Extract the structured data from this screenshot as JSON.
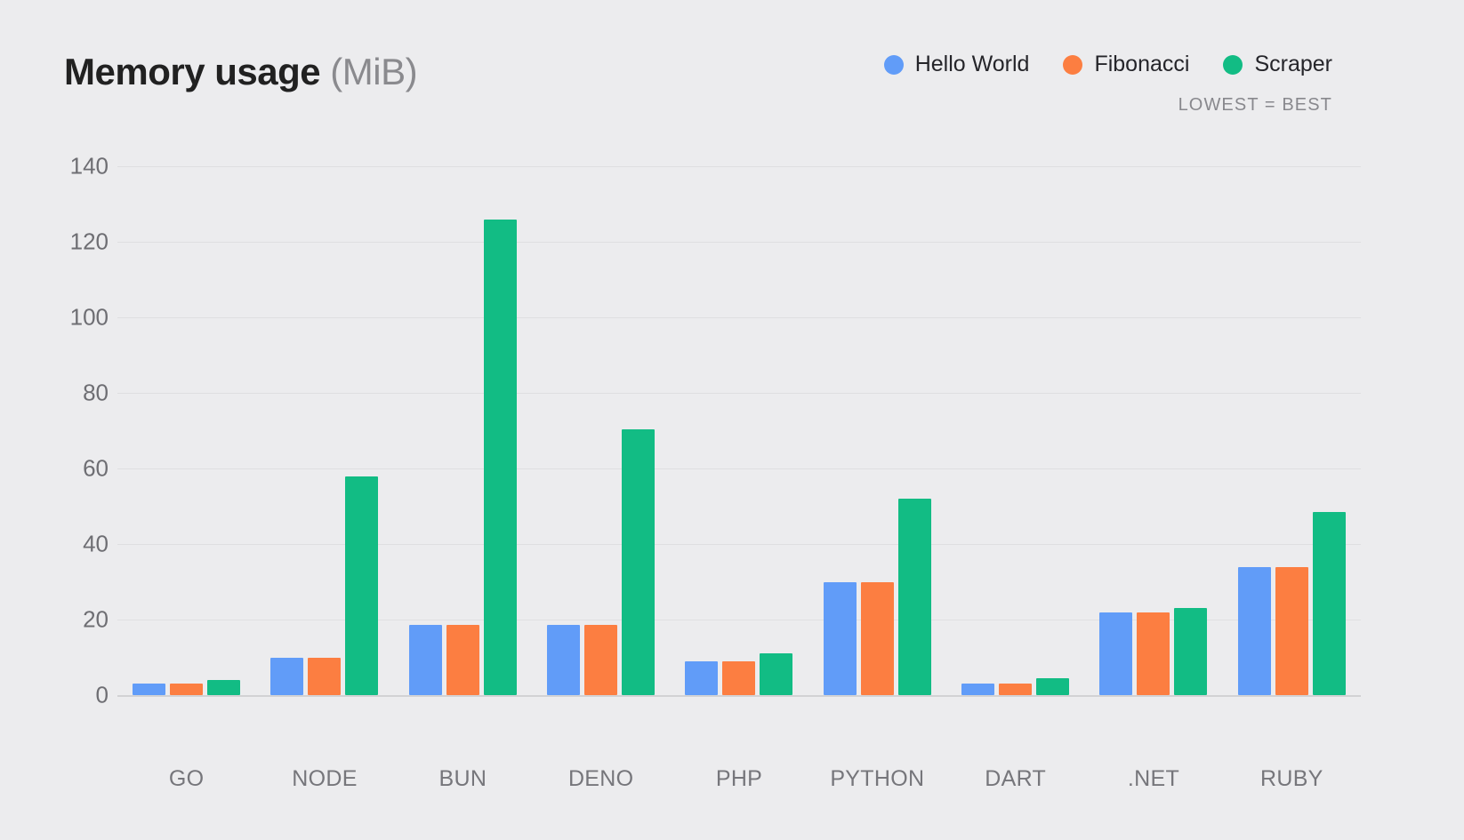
{
  "header": {
    "title_main": "Memory usage ",
    "title_unit": "(MiB)",
    "subnote": "LOWEST = BEST"
  },
  "legend": {
    "items": [
      {
        "label": "Hello World",
        "color": "#619CF8"
      },
      {
        "label": "Fibonacci",
        "color": "#FC7E41"
      },
      {
        "label": "Scraper",
        "color": "#12BC84"
      }
    ]
  },
  "chart_data": {
    "type": "bar",
    "title": "Memory usage (MiB)",
    "subtitle": "LOWEST = BEST",
    "xlabel": "",
    "ylabel": "",
    "ylim": [
      0,
      145
    ],
    "yticks": [
      0,
      20,
      40,
      60,
      80,
      100,
      120,
      140
    ],
    "ytick_labels": [
      "0",
      "20",
      "40",
      "60",
      "80",
      "100",
      "120",
      "140"
    ],
    "grid": true,
    "legend_position": "top-right",
    "categories": [
      "GO",
      "NODE",
      "BUN",
      "DENO",
      "PHP",
      "PYTHON",
      "DART",
      ".NET",
      "RUBY"
    ],
    "series": [
      {
        "name": "Hello World",
        "color": "#619CF8",
        "values": [
          3,
          10,
          18.5,
          18.5,
          9,
          30,
          3,
          22,
          34
        ]
      },
      {
        "name": "Fibonacci",
        "color": "#FC7E41",
        "values": [
          3,
          10,
          18.5,
          18.5,
          9,
          30,
          3,
          22,
          34
        ]
      },
      {
        "name": "Scraper",
        "color": "#12BC84",
        "values": [
          4,
          58,
          126,
          70.5,
          11,
          52,
          4.5,
          23,
          48.5
        ]
      }
    ]
  }
}
